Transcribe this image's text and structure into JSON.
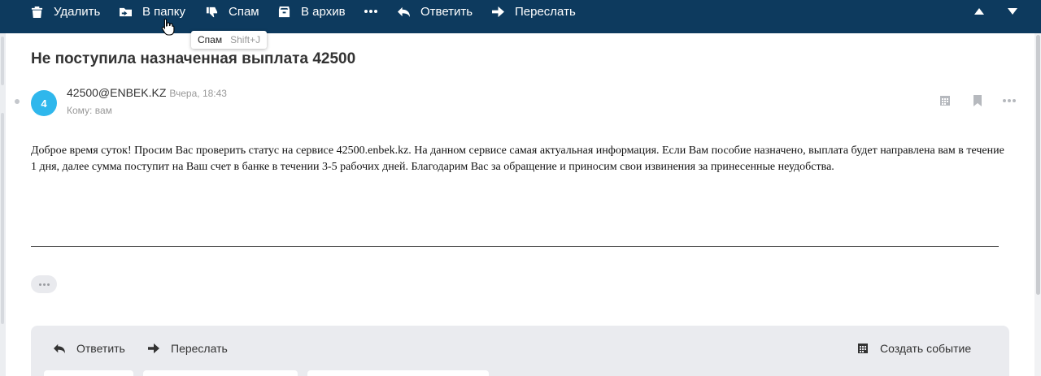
{
  "toolbar": {
    "delete_label": "Удалить",
    "move_label": "В папку",
    "spam_label": "Спам",
    "archive_label": "В архив",
    "reply_label": "Ответить",
    "forward_label": "Переслать"
  },
  "tooltip": {
    "label": "Спам",
    "shortcut": "Shift+J"
  },
  "message": {
    "subject": "Не поступила назначенная выплата 42500",
    "avatar_letter": "4",
    "sender": "42500@ENBEK.KZ",
    "date": "Вчера, 18:43",
    "recipient": "Кому: вам",
    "body": "Доброе время суток! Просим Вас проверить статус на сервисе 42500.enbek.kz. На данном сервисе самая актуальная информация. Если Вам пособие назначено, выплата будет направлена вам в течение 1 дня, далее сумма  поступит на Ваш счет в банке в течении 3-5 рабочих дней. Благодарим Вас за обращение и приносим свои извинения за принесенные неудобства."
  },
  "reply_panel": {
    "reply_label": "Ответить",
    "forward_label": "Переслать",
    "create_event_label": "Создать событие"
  },
  "colors": {
    "toolbar_bg": "#0d3a5e",
    "avatar_bg": "#2fb7ec",
    "panel_bg": "#eaebef"
  }
}
